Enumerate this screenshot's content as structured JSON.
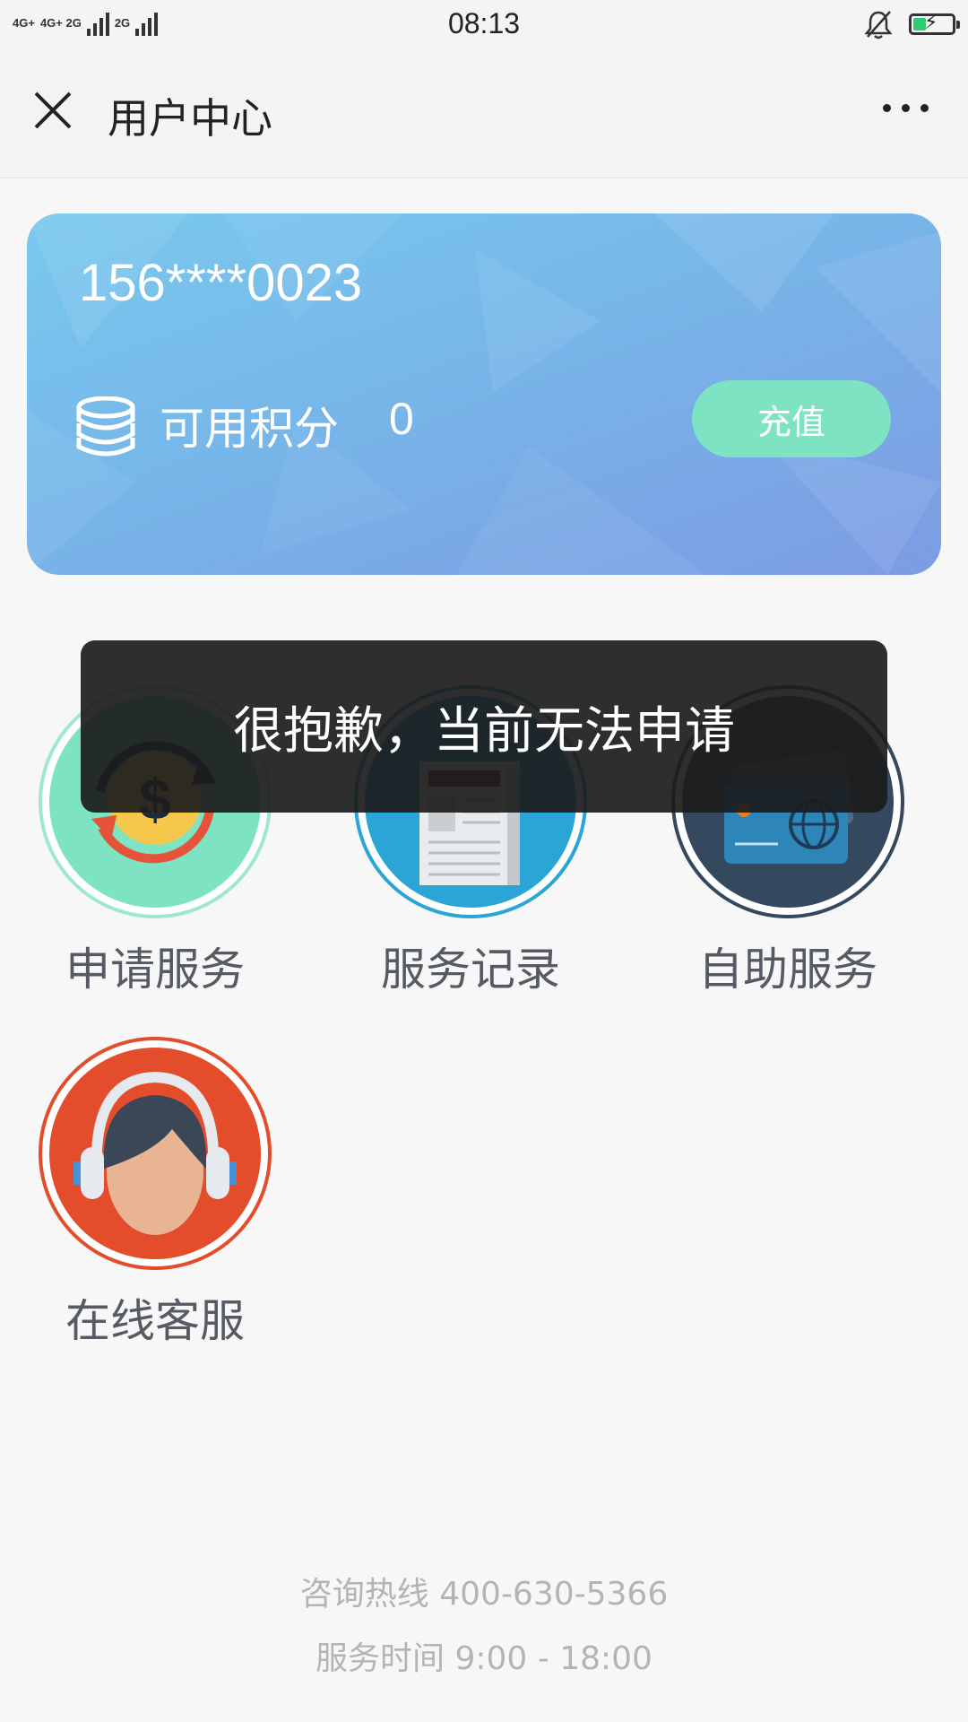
{
  "status_bar": {
    "network_1": "4G+",
    "network_2": "4G+ 2G",
    "network_3": "2G",
    "time": "08:13"
  },
  "nav": {
    "title": "用户中心"
  },
  "account_card": {
    "phone": "156****0023",
    "points_label": "可用积分",
    "points_value": "0",
    "recharge_label": "充值"
  },
  "services": [
    {
      "label": "申请服务",
      "icon": "exchange-dollar-icon"
    },
    {
      "label": "服务记录",
      "icon": "newspaper-icon"
    },
    {
      "label": "自助服务",
      "icon": "credit-card-icon"
    },
    {
      "label": "在线客服",
      "icon": "headset-agent-icon"
    }
  ],
  "toast": {
    "message": "很抱歉，当前无法申请"
  },
  "footer": {
    "hotline": "咨询热线 400-630-5366",
    "hours": "服务时间 9:00 - 18:00"
  },
  "colors": {
    "recharge_button": "#7de3c3",
    "card_gradient_start": "#79c9ee",
    "card_gradient_end": "#7d9be3"
  }
}
